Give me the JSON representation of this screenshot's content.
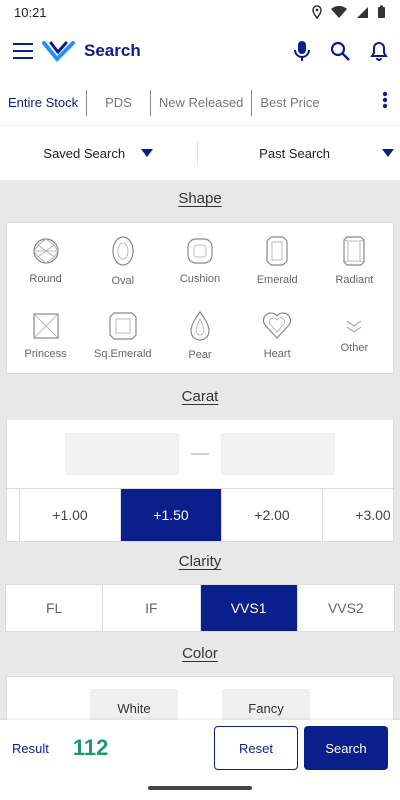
{
  "status_bar": {
    "time": "10:21"
  },
  "header": {
    "title": "Search"
  },
  "tabs": [
    {
      "label": "Entire Stock",
      "active": true
    },
    {
      "label": "PDS",
      "active": false
    },
    {
      "label": "New Released",
      "active": false
    },
    {
      "label": "Best Price",
      "active": false
    }
  ],
  "subbar": {
    "saved_search": "Saved Search",
    "past_search": "Past Search"
  },
  "sections": {
    "shape": "Shape",
    "carat": "Carat",
    "clarity": "Clarity",
    "color": "Color"
  },
  "shapes": [
    "Round",
    "Oval",
    "Cushion",
    "Emerald",
    "Radiant",
    "Princess",
    "Sq.Emerald",
    "Pear",
    "Heart",
    "Other"
  ],
  "carat": {
    "presets": [
      "+1.00",
      "+1.50",
      "+2.00",
      "+3.00"
    ],
    "selected": "+1.50"
  },
  "clarity": {
    "options": [
      "FL",
      "IF",
      "VVS1",
      "VVS2"
    ],
    "selected": "VVS1"
  },
  "color": {
    "options": [
      "White",
      "Fancy"
    ]
  },
  "footer": {
    "result_label": "Result",
    "result_count": "112",
    "reset_label": "Reset",
    "search_label": "Search"
  },
  "colors": {
    "accent": "#0a1e8c",
    "result": "#1d9a6c"
  }
}
